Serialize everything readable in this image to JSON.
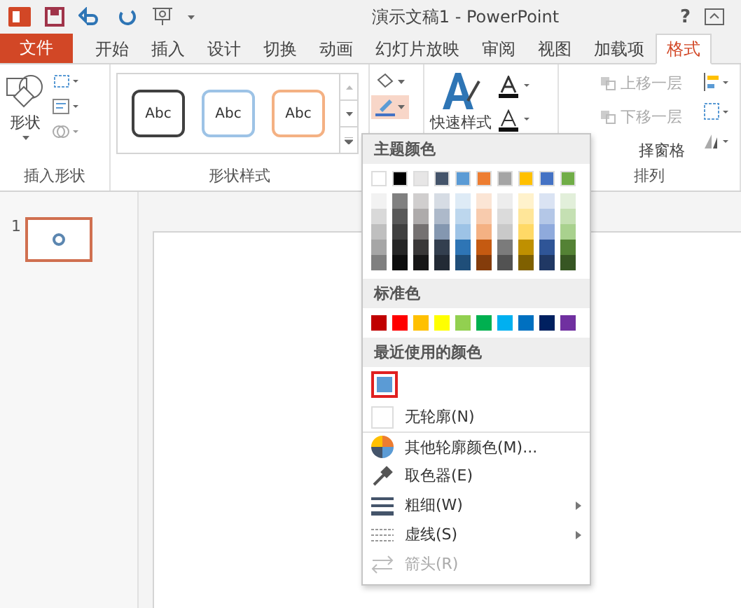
{
  "window": {
    "title": "演示文稿1 - PowerPoint",
    "help": "?"
  },
  "file_tab": {
    "label": "文件"
  },
  "tabs": [
    {
      "label": "开始",
      "selected": false
    },
    {
      "label": "插入",
      "selected": false
    },
    {
      "label": "设计",
      "selected": false
    },
    {
      "label": "切换",
      "selected": false
    },
    {
      "label": "动画",
      "selected": false
    },
    {
      "label": "幻灯片放映",
      "selected": false
    },
    {
      "label": "审阅",
      "selected": false
    },
    {
      "label": "视图",
      "selected": false
    },
    {
      "label": "加载项",
      "selected": false
    },
    {
      "label": "格式",
      "selected": true
    }
  ],
  "ribbon": {
    "insert_shapes": {
      "shapes_label": "形状",
      "group_label": "插入形状"
    },
    "shape_styles": {
      "presets": [
        {
          "label": "Abc",
          "color": "#404040"
        },
        {
          "label": "Abc",
          "color": "#9dc3e6"
        },
        {
          "label": "Abc",
          "color": "#f4b183"
        }
      ],
      "group_label": "形状样式"
    },
    "shape_outline": {
      "pressed": true
    },
    "quick_styles": {
      "label": "快速样式"
    },
    "arrange": {
      "items": [
        {
          "label": "上移一层",
          "disabled": true
        },
        {
          "label": "下移一层",
          "disabled": true
        },
        {
          "label": "择窗格",
          "disabled": false
        }
      ],
      "group_label": "排列"
    }
  },
  "slides": [
    {
      "number": "1",
      "selected": true
    }
  ],
  "outline_menu": {
    "theme_header": "主题颜色",
    "theme_colors": [
      {
        "color": "#ffffff",
        "shades": [
          {
            "color": "#f2f2f2"
          },
          {
            "color": "#d9d9d9"
          },
          {
            "color": "#bfbfbf"
          },
          {
            "color": "#a6a6a6"
          },
          {
            "color": "#808080"
          }
        ]
      },
      {
        "color": "#000000",
        "shades": [
          {
            "color": "#808080"
          },
          {
            "color": "#595959"
          },
          {
            "color": "#404040"
          },
          {
            "color": "#262626"
          },
          {
            "color": "#0d0d0d"
          }
        ]
      },
      {
        "color": "#e7e6e6",
        "shades": [
          {
            "color": "#d0cece"
          },
          {
            "color": "#aeabab"
          },
          {
            "color": "#757171"
          },
          {
            "color": "#3a3838"
          },
          {
            "color": "#171616"
          }
        ]
      },
      {
        "color": "#44546a",
        "shades": [
          {
            "color": "#d6dce4"
          },
          {
            "color": "#adb9ca"
          },
          {
            "color": "#8497b0"
          },
          {
            "color": "#333f4f"
          },
          {
            "color": "#222a35"
          }
        ]
      },
      {
        "color": "#5b9bd5",
        "shades": [
          {
            "color": "#deebf6"
          },
          {
            "color": "#bdd7ee"
          },
          {
            "color": "#9dc3e6"
          },
          {
            "color": "#2e75b5"
          },
          {
            "color": "#1f4e79"
          }
        ]
      },
      {
        "color": "#ed7d31",
        "shades": [
          {
            "color": "#fbe5d5"
          },
          {
            "color": "#f8cbad"
          },
          {
            "color": "#f4b183"
          },
          {
            "color": "#c55a11"
          },
          {
            "color": "#843c0b"
          }
        ]
      },
      {
        "color": "#a5a5a5",
        "shades": [
          {
            "color": "#ededed"
          },
          {
            "color": "#dbdbdb"
          },
          {
            "color": "#c9c9c9"
          },
          {
            "color": "#7b7b7b"
          },
          {
            "color": "#525252"
          }
        ]
      },
      {
        "color": "#ffc000",
        "shades": [
          {
            "color": "#fff2cc"
          },
          {
            "color": "#ffe699"
          },
          {
            "color": "#ffd966"
          },
          {
            "color": "#bf9000"
          },
          {
            "color": "#7f6000"
          }
        ]
      },
      {
        "color": "#4472c4",
        "shades": [
          {
            "color": "#dae3f3"
          },
          {
            "color": "#b4c7e7"
          },
          {
            "color": "#8faadc"
          },
          {
            "color": "#2f5597"
          },
          {
            "color": "#203864"
          }
        ]
      },
      {
        "color": "#70ad47",
        "shades": [
          {
            "color": "#e2efda"
          },
          {
            "color": "#c5e0b3"
          },
          {
            "color": "#a9d18e"
          },
          {
            "color": "#548235"
          },
          {
            "color": "#375623"
          }
        ]
      }
    ],
    "standard_header": "标准色",
    "standard_colors": [
      {
        "color": "#c00000"
      },
      {
        "color": "#ff0000"
      },
      {
        "color": "#ffc000"
      },
      {
        "color": "#ffff00"
      },
      {
        "color": "#92d050"
      },
      {
        "color": "#00b050"
      },
      {
        "color": "#00b0f0"
      },
      {
        "color": "#0070c0"
      },
      {
        "color": "#002060"
      },
      {
        "color": "#7030a0"
      }
    ],
    "recent_header": "最近使用的颜色",
    "recent_colors": [
      {
        "color": "#5b9bd5",
        "selected": true
      }
    ],
    "items": [
      {
        "label": "无轮廓(N)",
        "disabled": false,
        "submenu": false
      },
      {
        "label": "其他轮廓颜色(M)...",
        "disabled": false,
        "submenu": false
      },
      {
        "label": "取色器(E)",
        "disabled": false,
        "submenu": false
      },
      {
        "label": "粗细(W)",
        "disabled": false,
        "submenu": true
      },
      {
        "label": "虚线(S)",
        "disabled": false,
        "submenu": true
      },
      {
        "label": "箭头(R)",
        "disabled": true,
        "submenu": false
      }
    ]
  }
}
